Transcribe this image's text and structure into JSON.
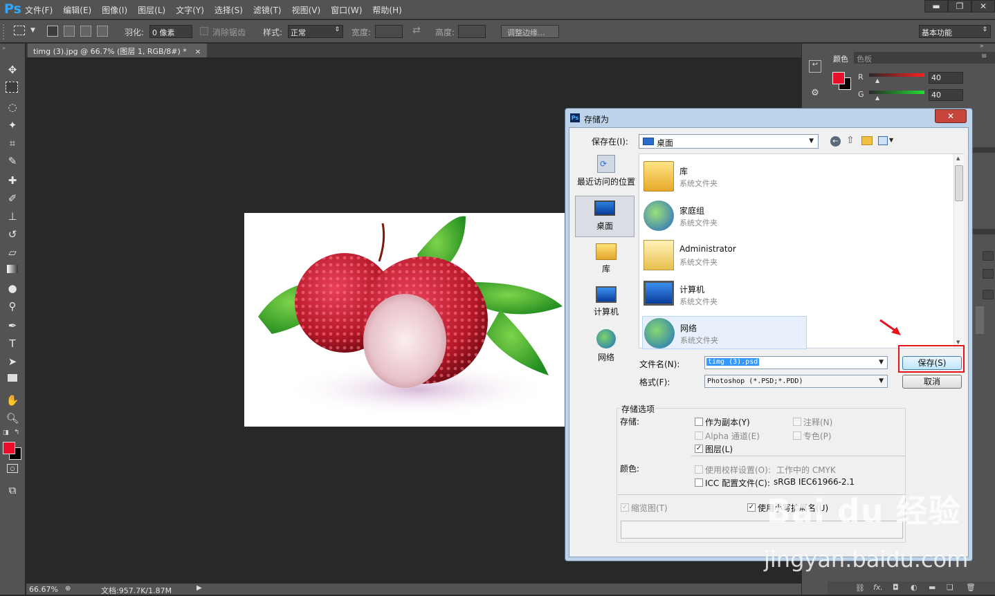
{
  "app": {
    "logo": "Ps",
    "menus": [
      "文件(F)",
      "编辑(E)",
      "图像(I)",
      "图层(L)",
      "文字(Y)",
      "选择(S)",
      "滤镜(T)",
      "视图(V)",
      "窗口(W)",
      "帮助(H)"
    ],
    "window_buttons": [
      "▬",
      "❐",
      "✕"
    ]
  },
  "options": {
    "feather_label": "羽化:",
    "feather_value": "0 像素",
    "antialias_label": "消除锯齿",
    "style_label": "样式:",
    "style_value": "正常",
    "width_label": "宽度:",
    "height_label": "高度:",
    "refine_button": "调整边缘...",
    "workspace": "基本功能"
  },
  "document": {
    "tab_title": "timg (3).jpg @ 66.7% (图层 1, RGB/8#) *",
    "tab_close": "×",
    "zoom": "66.67%",
    "doc_size": "文档:957.7K/1.87M"
  },
  "color_panel": {
    "tabs": [
      "颜色",
      "色板"
    ],
    "channels": [
      {
        "label": "R",
        "value": "40"
      },
      {
        "label": "G",
        "value": "40"
      }
    ],
    "foreground": "#e8102a"
  },
  "dialog": {
    "title": "存储为",
    "save_in_label": "保存在(I):",
    "save_in_value": "桌面",
    "places": [
      "最近访问的位置",
      "桌面",
      "库",
      "计算机",
      "网络"
    ],
    "files": [
      {
        "name": "库",
        "type": "系统文件夹"
      },
      {
        "name": "家庭组",
        "type": "系统文件夹"
      },
      {
        "name": "Administrator",
        "type": "系统文件夹"
      },
      {
        "name": "计算机",
        "type": "系统文件夹"
      },
      {
        "name": "网络",
        "type": "系统文件夹"
      }
    ],
    "filename_label": "文件名(N):",
    "filename_value": "timg (3).psd",
    "format_label": "格式(F):",
    "format_value": "Photoshop (*.PSD;*.PDD)",
    "save_button": "保存(S)",
    "cancel_button": "取消",
    "options_group": "存储选项",
    "save_label": "存储:",
    "as_copy": "作为副本(Y)",
    "annotations": "注释(N)",
    "alpha": "Alpha 通道(E)",
    "spot": "专色(P)",
    "layers": "图层(L)",
    "color_label": "颜色:",
    "proof": "使用校样设置(O):",
    "proof_value": "工作中的 CMYK",
    "icc": "ICC 配置文件(C):",
    "icc_value": "sRGB IEC61966-2.1",
    "thumbnail": "缩览图(T)",
    "lowercase": "使用小写扩展名(U)"
  },
  "watermark": {
    "line1": "Bai du 经验",
    "line2": "jingyan.baidu.com"
  }
}
